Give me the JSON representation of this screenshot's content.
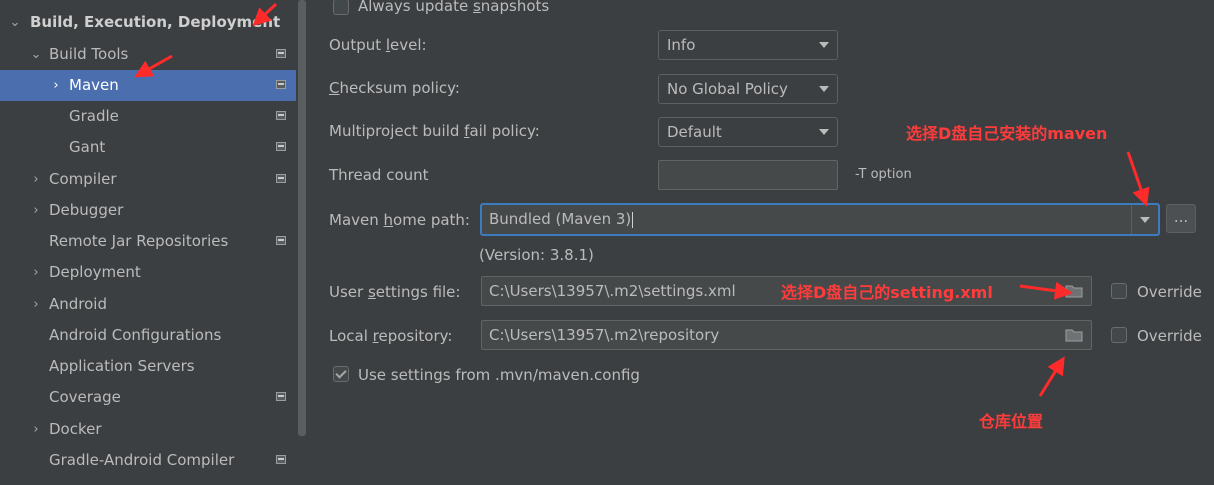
{
  "sidebar": {
    "items": [
      {
        "label": "Build, Execution, Deployment",
        "expanded": true
      },
      {
        "label": "Build Tools",
        "expanded": true
      },
      {
        "label": "Maven",
        "selected": true
      },
      {
        "label": "Gradle"
      },
      {
        "label": "Gant"
      },
      {
        "label": "Compiler"
      },
      {
        "label": "Debugger"
      },
      {
        "label": "Remote Jar Repositories"
      },
      {
        "label": "Deployment"
      },
      {
        "label": "Android"
      },
      {
        "label": "Android Configurations"
      },
      {
        "label": "Application Servers"
      },
      {
        "label": "Coverage"
      },
      {
        "label": "Docker"
      },
      {
        "label": "Gradle-Android Compiler"
      }
    ]
  },
  "settings": {
    "always_update_snapshots": {
      "label_before": "Always update ",
      "mnemonic": "s",
      "label_after": "napshots",
      "checked": false
    },
    "output_level": {
      "label_before": "Output ",
      "mnemonic": "l",
      "label_after": "evel:",
      "value": "Info"
    },
    "checksum_policy": {
      "label_before": "",
      "mnemonic": "C",
      "label_after": "hecksum policy:",
      "value": "No Global Policy"
    },
    "multiproject_fail_policy": {
      "label_before": "Multiproject build ",
      "mnemonic": "f",
      "label_after": "ail policy:",
      "value": "Default"
    },
    "thread_count": {
      "label": "Thread count",
      "value": "",
      "hint": "-T option"
    },
    "maven_home_path": {
      "label_before": "Maven ",
      "mnemonic": "h",
      "label_after": "ome path:",
      "value": "Bundled (Maven 3)",
      "browse_label": "...",
      "version_text": "(Version: 3.8.1)"
    },
    "user_settings_file": {
      "label_before": "User ",
      "mnemonic": "s",
      "label_after": "ettings file:",
      "value": "C:\\Users\\13957\\.m2\\settings.xml",
      "override_label": "Override",
      "override_checked": false
    },
    "local_repository": {
      "label_before": "Local ",
      "mnemonic": "r",
      "label_after": "epository:",
      "value": "C:\\Users\\13957\\.m2\\repository",
      "override_label": "Override",
      "override_checked": false
    },
    "use_mvn_config": {
      "label": "Use settings from .mvn/maven.config",
      "checked": true
    }
  },
  "annotations": {
    "maven_home": "选择D盘自己安装的maven",
    "settings_file": "选择D盘自己的setting.xml",
    "repository": "仓库位置"
  },
  "colors": {
    "background": "#3c3f41",
    "selection": "#4b6eaf",
    "annotation_red": "#ff2a2a",
    "focus_border": "#3d7bbf"
  }
}
